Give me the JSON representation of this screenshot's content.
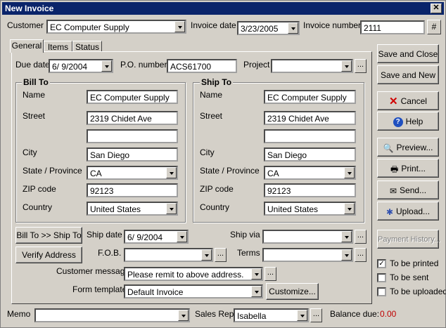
{
  "window": {
    "title": "New Invoice"
  },
  "header": {
    "customer_label": "Customer",
    "customer_value": "EC Computer Supply",
    "invoice_date_label": "Invoice date",
    "invoice_date_value": "3/23/2005",
    "invoice_number_label": "Invoice number",
    "invoice_number_value": "2111",
    "hash_button": "#"
  },
  "tabs": [
    {
      "label": "General"
    },
    {
      "label": "Items"
    },
    {
      "label": "Status"
    }
  ],
  "general": {
    "due_date_label": "Due date",
    "due_date_value": "6/ 9/2004",
    "po_label": "P.O. number",
    "po_value": "ACS61700",
    "project_label": "Project",
    "project_value": "",
    "bill_to": {
      "title": "Bill To",
      "name_label": "Name",
      "name": "EC Computer Supply",
      "street_label": "Street",
      "street": "2319 Chidet Ave",
      "street2": "",
      "city_label": "City",
      "city": "San Diego",
      "state_label": "State / Province",
      "state": "CA",
      "zip_label": "ZIP code",
      "zip": "92123",
      "country_label": "Country",
      "country": "United States"
    },
    "ship_to": {
      "title": "Ship To",
      "name_label": "Name",
      "name": "EC Computer Supply",
      "street_label": "Street",
      "street": "2319 Chidet Ave",
      "street2": "",
      "city_label": "City",
      "city": "San Diego",
      "state_label": "State / Province",
      "state": "CA",
      "zip_label": "ZIP code",
      "zip": "92123",
      "country_label": "Country",
      "country": "United States"
    },
    "bill_to_ship_button": "Bill To >> Ship To",
    "verify_address_button": "Verify Address",
    "ship_date_label": "Ship date",
    "ship_date_value": "6/ 9/2004",
    "ship_via_label": "Ship via",
    "ship_via_value": "",
    "fob_label": "F.O.B.",
    "fob_value": "",
    "terms_label": "Terms",
    "terms_value": "",
    "customer_message_label": "Customer message",
    "customer_message_value": "Please remit to above address.",
    "form_template_label": "Form template",
    "form_template_value": "Default Invoice",
    "customize_button": "Customize..."
  },
  "actions": {
    "save_close": "Save and Close",
    "save_new": "Save and New",
    "cancel": "Cancel",
    "help": "Help",
    "preview": "Preview...",
    "print": "Print...",
    "send": "Send...",
    "upload": "Upload...",
    "payment_history": "Payment History..."
  },
  "options": {
    "to_be_printed": {
      "label": "To be printed",
      "checked": true
    },
    "to_be_sent": {
      "label": "To be sent",
      "checked": false
    },
    "to_be_uploaded": {
      "label": "To be uploaded",
      "checked": false
    }
  },
  "footer": {
    "memo_label": "Memo",
    "memo_value": "",
    "sales_rep_label": "Sales Rep.",
    "sales_rep_value": "Isabella",
    "balance_due_label": "Balance due:",
    "balance_due_value": "0.00",
    "balance_color": "#c00000"
  }
}
